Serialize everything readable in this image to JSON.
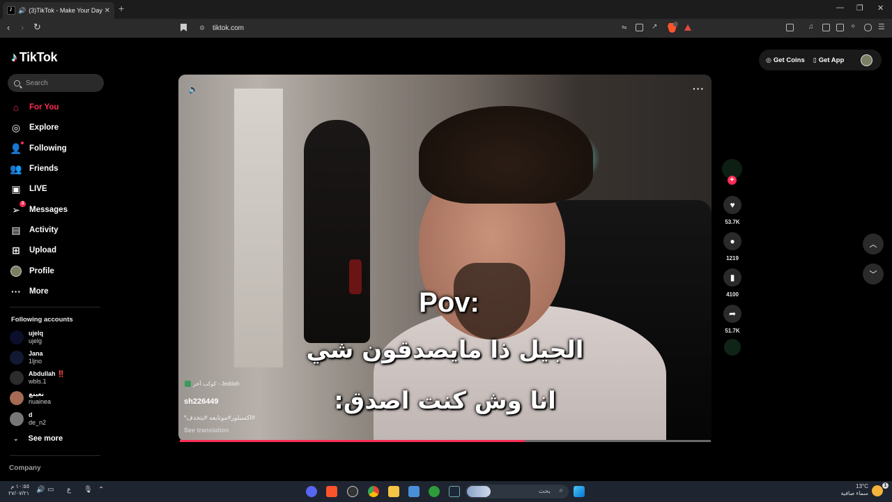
{
  "browser": {
    "tab_title": "(3)TikTok - Make Your Day",
    "tab_close": "✕",
    "new_tab": "+",
    "url": "tiktok.com",
    "window_controls": [
      "—",
      "❐",
      "✕"
    ]
  },
  "sidebar": {
    "logo_text": "TikTok",
    "search_placeholder": "Search",
    "nav": [
      {
        "label": "For You",
        "icon": "home-icon",
        "active": true
      },
      {
        "label": "Explore",
        "icon": "compass-icon"
      },
      {
        "label": "Following",
        "icon": "following-icon"
      },
      {
        "label": "Friends",
        "icon": "friends-icon"
      },
      {
        "label": "LIVE",
        "icon": "live-icon"
      },
      {
        "label": "Messages",
        "icon": "messages-icon",
        "badge": "3"
      },
      {
        "label": "Activity",
        "icon": "activity-icon"
      },
      {
        "label": "Upload",
        "icon": "upload-icon"
      },
      {
        "label": "Profile",
        "icon": "profile-icon"
      },
      {
        "label": "More",
        "icon": "more-icon"
      }
    ],
    "following_header": "Following accounts",
    "accounts": [
      {
        "name": "ujelq",
        "username": "ujelg"
      },
      {
        "name": "Jana",
        "username": "1ljno"
      },
      {
        "name": "Abdullah ‼️",
        "username": "wbls.1"
      },
      {
        "name": "نعينع",
        "username": "nuainea"
      },
      {
        "name": "d",
        "username": "de_n2"
      }
    ],
    "see_more": "See more",
    "company": "Company"
  },
  "header": {
    "get_coins": "Get Coins",
    "get_app": "Get App"
  },
  "video": {
    "caption_line1": "Pov:",
    "caption_line2": "الجيل ذا مايصدقون شي",
    "caption_line3": "انا وش كنت اصدق:",
    "location": "كوكب آخر - Jeddah",
    "author": "sh226449",
    "description": "#اكسبلور#موتابعه #يتخذف*",
    "see_translation": "See translation",
    "progress": 0.65
  },
  "actions": {
    "likes": "53.7K",
    "comments": "1219",
    "saves": "4100",
    "shares": "51.7K"
  },
  "taskbar": {
    "search_text": "بحث",
    "clock_time": "١٠:٥٥ م",
    "clock_date": "٢٧/٠٧/٢١",
    "weather_temp": "13°C",
    "weather_desc": "سماء صافية",
    "notifications": "1",
    "lang": "ع"
  },
  "colors": {
    "accent": "#fe2c55",
    "background": "#000000",
    "teal": "#25f4ee"
  }
}
